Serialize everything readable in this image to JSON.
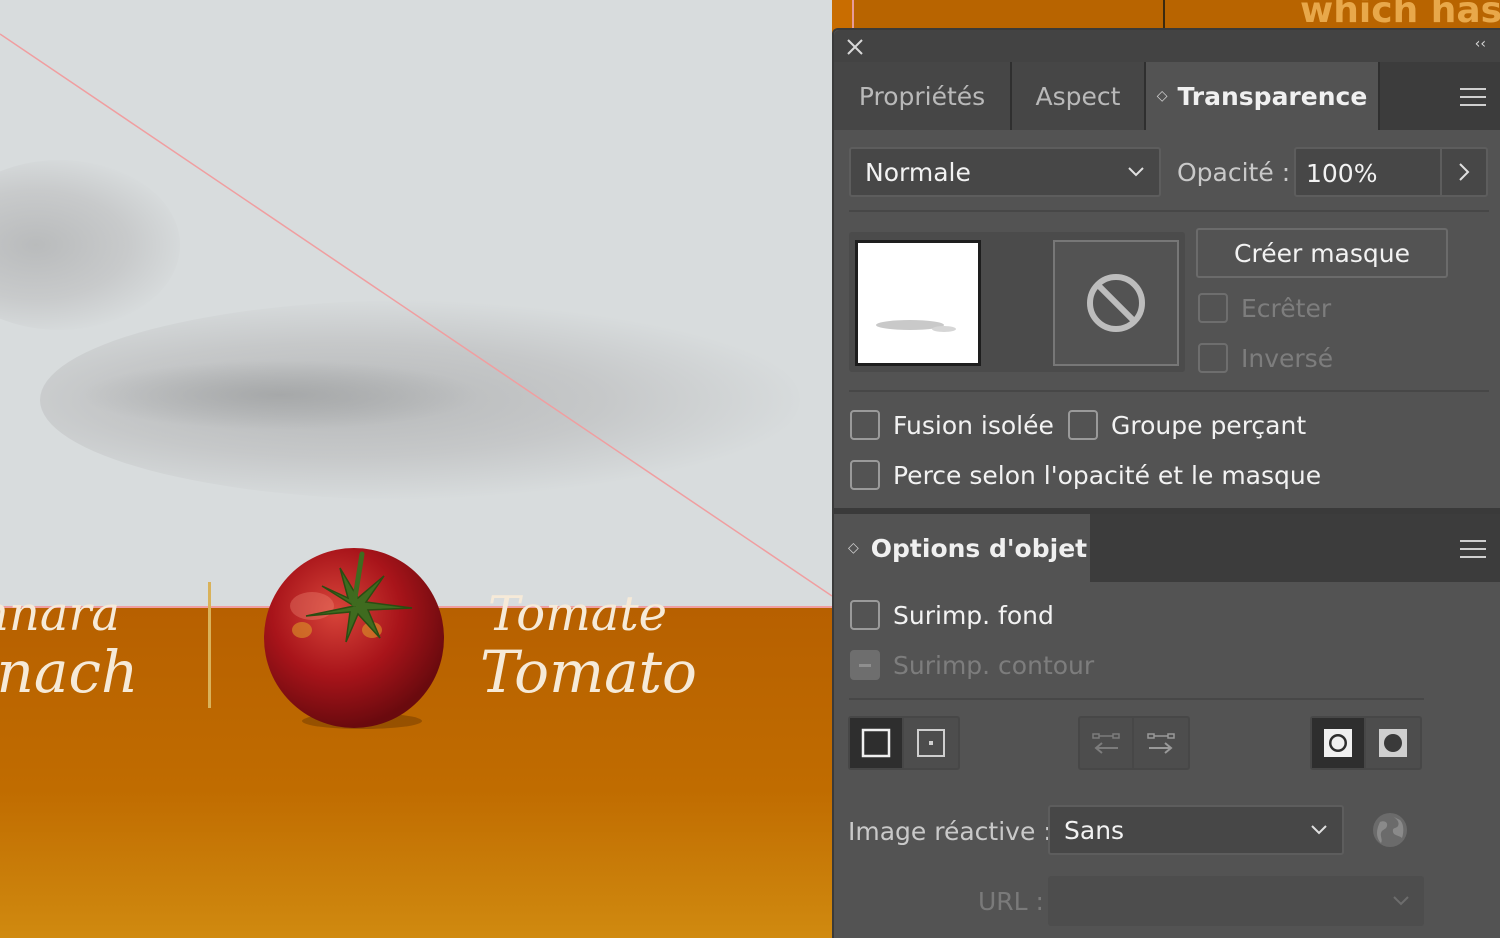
{
  "canvas": {
    "top_text": "which has",
    "left_labels": [
      "nnara",
      "inach"
    ],
    "right_labels": [
      "Tomate",
      "Tomato"
    ]
  },
  "panel": {
    "tabs": [
      {
        "label": "Propriétés",
        "active": false
      },
      {
        "label": "Aspect",
        "active": false
      },
      {
        "label": "Transparence",
        "active": true
      }
    ],
    "blend_mode": "Normale",
    "opacity_label": "Opacité :",
    "opacity_value": "100%",
    "create_mask_label": "Créer masque",
    "clip_label": "Ecrêter",
    "invert_label": "Inversé",
    "isolate_label": "Fusion isolée",
    "knockout_label": "Groupe perçant",
    "perce_label": "Perce selon l'opacité et le masque"
  },
  "options": {
    "title": "Options d'objet",
    "overprint_fill_label": "Surimp. fond",
    "overprint_stroke_label": "Surimp. contour",
    "image_map_label": "Image réactive :",
    "image_map_value": "Sans",
    "url_label": "URL :"
  },
  "colors": {
    "panel_bg": "#535353",
    "accent_orange": "#c96d00",
    "guide_pink": "#f09ea0"
  }
}
